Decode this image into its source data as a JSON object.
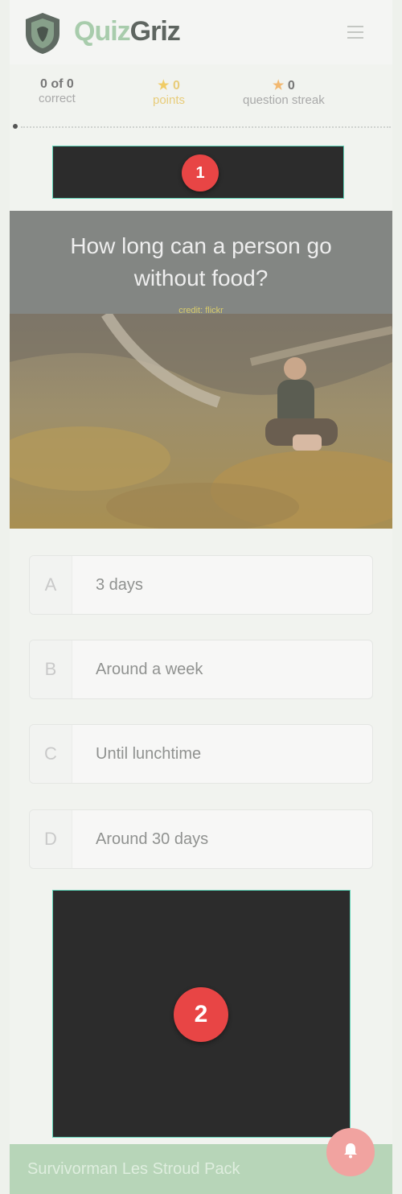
{
  "header": {
    "logo_part1": "Quiz",
    "logo_part2": "Griz",
    "menu_icon": "hamburger-icon"
  },
  "stats": {
    "correct_value": "0 of 0",
    "correct_label": "correct",
    "points_value": "0",
    "points_label": "points",
    "streak_value": "0",
    "streak_label": "question streak"
  },
  "ads": {
    "badge1": "1",
    "badge2": "2"
  },
  "question": {
    "title": "How long can a person go without food?",
    "credit": "credit: flickr"
  },
  "answers": [
    {
      "letter": "A",
      "text": "3 days"
    },
    {
      "letter": "B",
      "text": "Around a week"
    },
    {
      "letter": "C",
      "text": "Until lunchtime"
    },
    {
      "letter": "D",
      "text": "Around 30 days"
    }
  ],
  "footer": {
    "text": "Survivorman Les Stroud Pack"
  },
  "colors": {
    "accent_green": "#a8ccac",
    "ad_border": "#5fd3b7",
    "badge_red": "#e84545"
  }
}
